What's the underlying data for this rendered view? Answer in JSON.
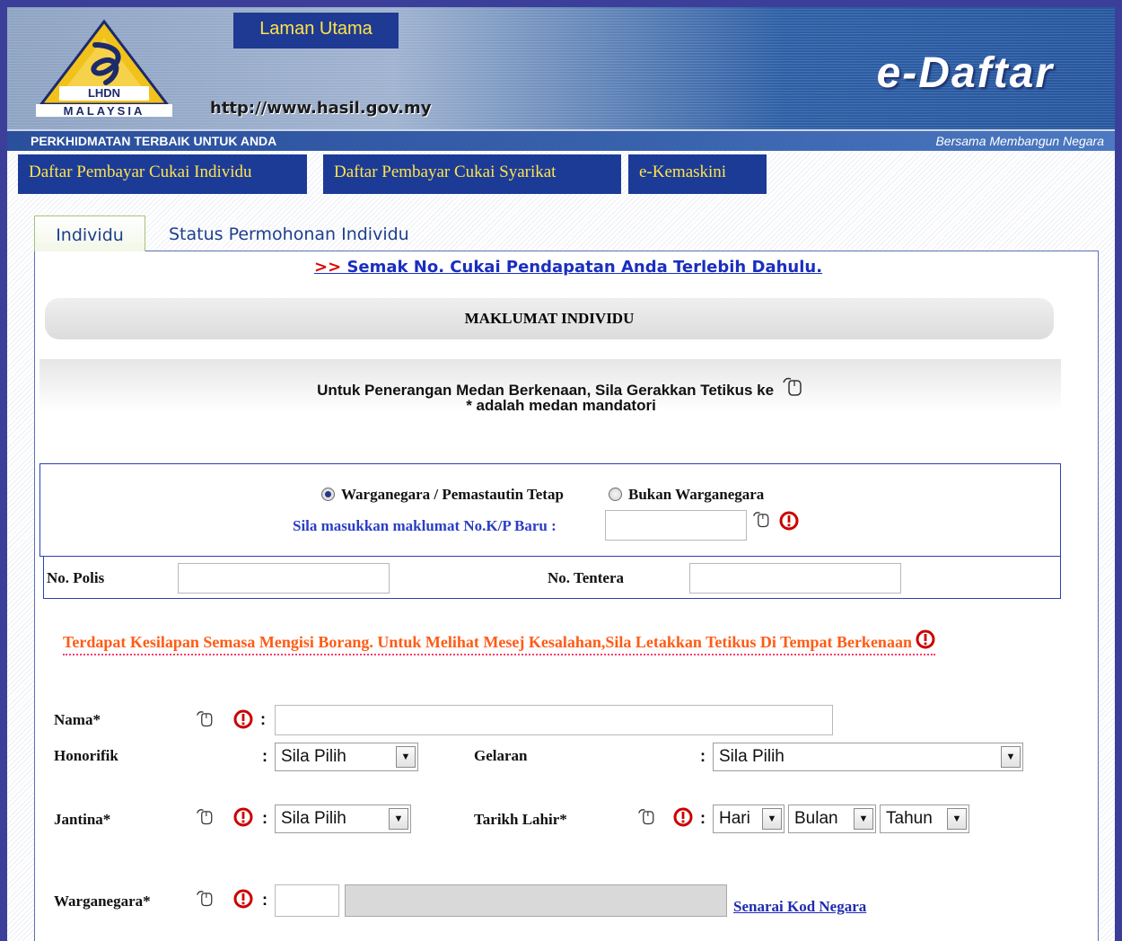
{
  "header": {
    "logo_top": "LHDN",
    "logo_bottom": "MALAYSIA",
    "home_link": "Laman Utama",
    "url": "http://www.hasil.gov.my",
    "brand": "e-Daftar",
    "tagline_left": "PERKHIDMATAN TERBAIK UNTUK ANDA",
    "tagline_right": "Bersama Membangun Negara"
  },
  "nav": {
    "tabs": [
      {
        "label": "Daftar Pembayar Cukai Individu"
      },
      {
        "label": "Daftar Pembayar Cukai Syarikat"
      },
      {
        "label": "e-Kemaskini"
      }
    ]
  },
  "subtabs": [
    {
      "label": "Individu",
      "active": true
    },
    {
      "label": "Status Permohonan Individu",
      "active": false
    }
  ],
  "semak": {
    "prefix": ">>",
    "label": "Semak No. Cukai Pendapatan Anda Terlebih Dahulu."
  },
  "section_title": "MAKLUMAT INDIVIDU",
  "info": {
    "line1": "Untuk Penerangan Medan Berkenaan, Sila Gerakkan Tetikus ke",
    "line2": "* adalah medan mandatori"
  },
  "citizenship": {
    "options": [
      {
        "label": "Warganegara / Pemastautin Tetap",
        "selected": true
      },
      {
        "label": "Bukan Warganegara",
        "selected": false
      }
    ],
    "kp_label": "Sila masukkan maklumat No.K/P Baru :",
    "kp_value": ""
  },
  "polis": {
    "label": "No. Polis",
    "value": ""
  },
  "tentera": {
    "label": "No. Tentera",
    "value": ""
  },
  "error_message": "Terdapat Kesilapan Semasa Mengisi Borang. Untuk Melihat Mesej Kesalahan,Sila Letakkan Tetikus Di Tempat Berkenaan",
  "form": {
    "nama": {
      "label": "Nama*",
      "value": ""
    },
    "honorifik": {
      "label": "Honorifik",
      "selected": "Sila Pilih"
    },
    "gelaran": {
      "label": "Gelaran",
      "selected": "Sila Pilih"
    },
    "jantina": {
      "label": "Jantina*",
      "selected": "Sila Pilih"
    },
    "tarikh_lahir": {
      "label": "Tarikh Lahir*",
      "hari": "Hari",
      "bulan": "Bulan",
      "tahun": "Tahun"
    },
    "warganegara": {
      "label": "Warganegara*",
      "code": "",
      "name": ""
    },
    "kod_negara_link": "Senarai Kod Negara"
  },
  "colors": {
    "nav_bg": "#1c3b97",
    "nav_text": "#ffe44a",
    "error": "#ff5b15",
    "link": "#1a2ebf",
    "warn": "#cc0000"
  },
  "icons": [
    "lhdn-logo-icon",
    "mouse-pointer-icon",
    "warning-icon",
    "dropdown-arrow-icon",
    "radio-icon"
  ]
}
